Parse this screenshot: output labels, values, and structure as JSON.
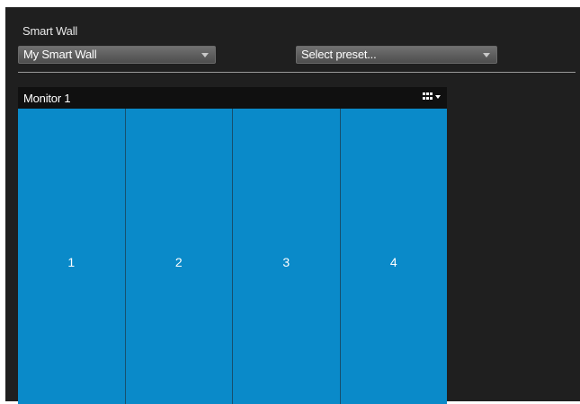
{
  "panel": {
    "title": "Smart Wall"
  },
  "smart_wall_select": {
    "selected": "My Smart Wall"
  },
  "preset_select": {
    "selected": "Select preset..."
  },
  "monitor": {
    "label": "Monitor 1",
    "tiles": [
      "1",
      "2",
      "3",
      "4"
    ]
  },
  "colors": {
    "tile": "#0a8ac9",
    "background": "#1f1f1f",
    "header": "#101010"
  },
  "icons": {
    "layout": "grid-layout-icon",
    "dropdown": "chevron-down-icon"
  }
}
